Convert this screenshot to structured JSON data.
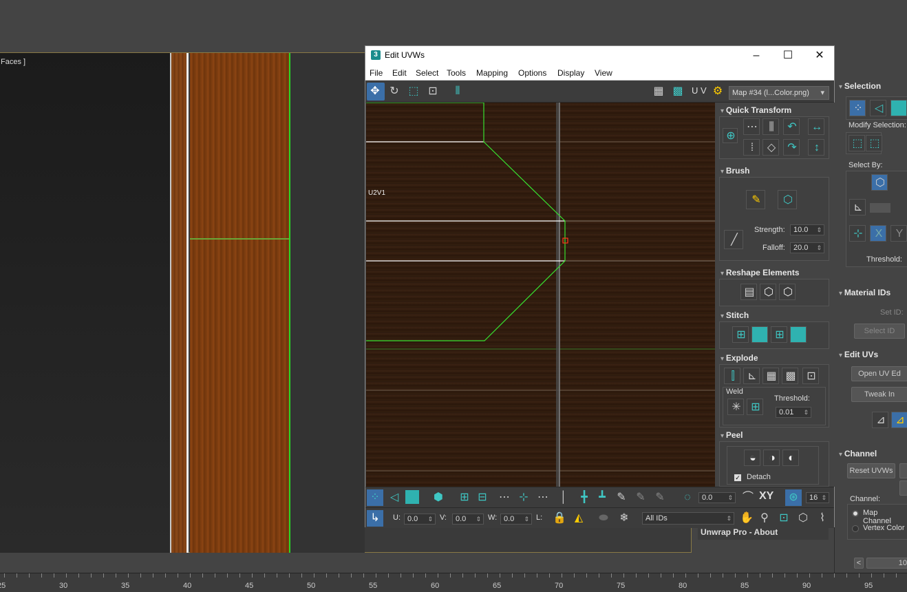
{
  "viewport": {
    "label": "Faces ]"
  },
  "ruler": {
    "ticks": [
      "25",
      "30",
      "35",
      "40",
      "45",
      "50",
      "55",
      "60",
      "65",
      "70",
      "75",
      "80",
      "85",
      "90",
      "95"
    ]
  },
  "uvw_window": {
    "title": "Edit UVWs",
    "logo": "3",
    "menu": [
      "File",
      "Edit",
      "Select",
      "Tools",
      "Mapping",
      "Options",
      "Display",
      "View"
    ],
    "toolbar": {
      "uv_label": "U V",
      "map_select": "Map #34 (l...Color.png)"
    },
    "canvas": {
      "tile_label": "U2V1"
    },
    "side_panel": {
      "quick_transform": "Quick Transform",
      "brush": "Brush",
      "strength_label": "Strength:",
      "strength_value": "10.0",
      "falloff_label": "Falloff:",
      "falloff_value": "20.0",
      "reshape": "Reshape Elements",
      "stitch": "Stitch",
      "explode": "Explode",
      "weld": "Weld",
      "threshold_label": "Threshold:",
      "threshold_value": "0.01",
      "peel": "Peel",
      "detach": "Detach"
    },
    "bottom": {
      "angle_value": "0.0",
      "xy_label": "XY",
      "grid_value": "16",
      "u_label": "U:",
      "u_value": "0.0",
      "v_label": "V:",
      "v_value": "0.0",
      "w_label": "W:",
      "w_value": "0.0",
      "l_label": "L:",
      "ids_select": "All IDs"
    }
  },
  "unwrap_about": "Unwrap Pro - About",
  "command_panel": {
    "selection": "Selection",
    "modify_selection": "Modify Selection:",
    "select_by": "Select By:",
    "threshold": "Threshold:",
    "material_ids": "Material IDs",
    "set_id": "Set ID:",
    "select_id": "Select ID",
    "edit_uvs": "Edit UVs",
    "open_uv_editor": "Open UV Ed",
    "tweak_in": "Tweak In",
    "channel": "Channel",
    "reset_uvws": "Reset UVWs",
    "channel_label": "Channel:",
    "map_channel": "Map Channel",
    "vertex_color": "Vertex Color",
    "page_value": "10",
    "page_prev": "<"
  }
}
